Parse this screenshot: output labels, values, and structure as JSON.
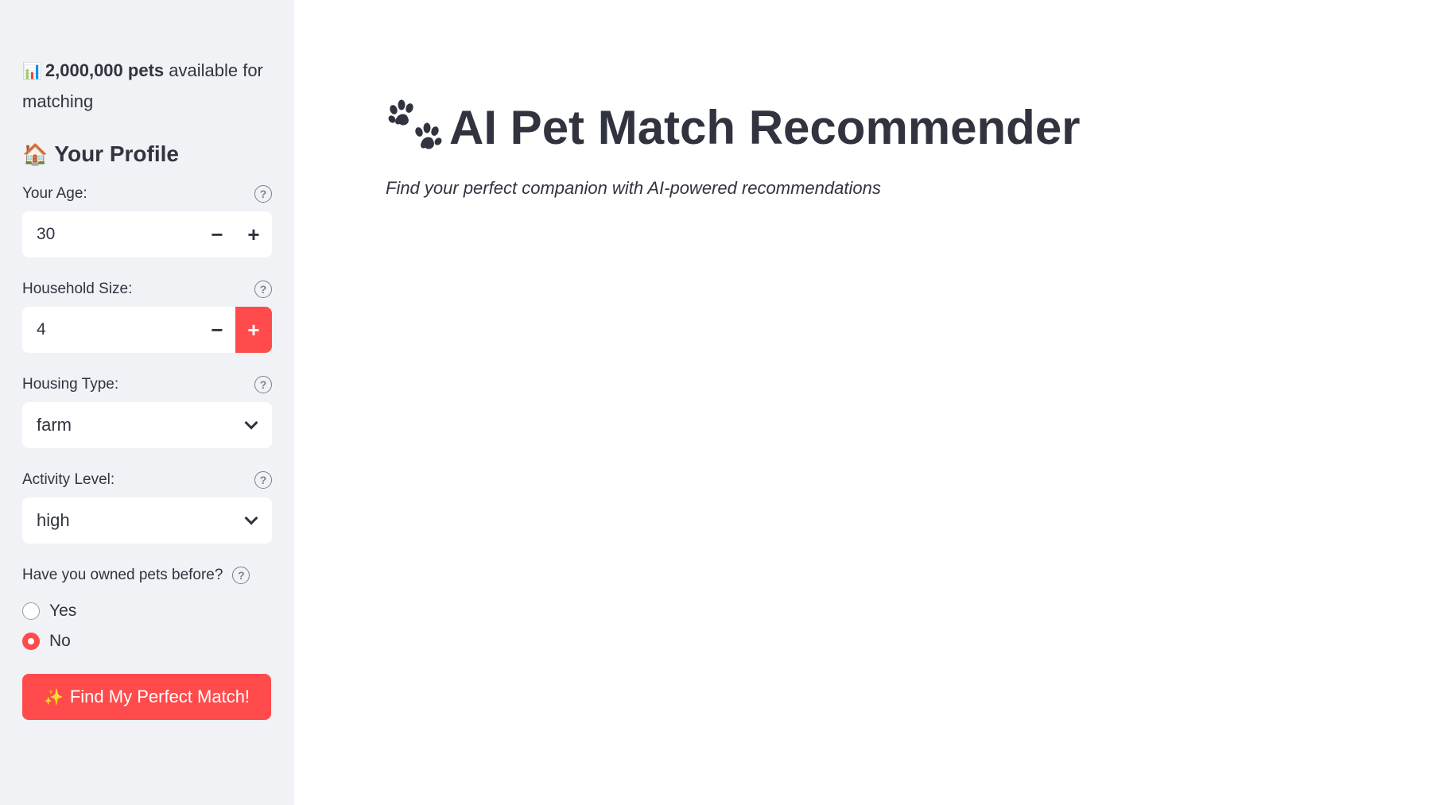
{
  "sidebar": {
    "stats": {
      "count": "2,000,000 pets",
      "suffix": " available for matching"
    },
    "profile_title": "Your Profile",
    "fields": {
      "age": {
        "label": "Your Age:",
        "value": "30"
      },
      "household": {
        "label": "Household Size:",
        "value": "4"
      },
      "housing": {
        "label": "Housing Type:",
        "value": "farm"
      },
      "activity": {
        "label": "Activity Level:",
        "value": "high"
      }
    },
    "owned_pets": {
      "question": "Have you owned pets before?",
      "options": [
        "Yes",
        "No"
      ],
      "selected": "No"
    },
    "cta_label": "Find My Perfect Match!"
  },
  "main": {
    "title": "AI Pet Match Recommender",
    "subtitle": "Find your perfect companion with AI-powered recommendations"
  },
  "icons": {
    "stats": "bar-chart-icon",
    "profile": "house-icon",
    "help": "question-circle-icon",
    "cta": "sparkle-icon",
    "title": "paw-icon"
  },
  "colors": {
    "accent": "#ff4b4b",
    "sidebar_bg": "#f0f2f6",
    "text": "#31333f"
  }
}
